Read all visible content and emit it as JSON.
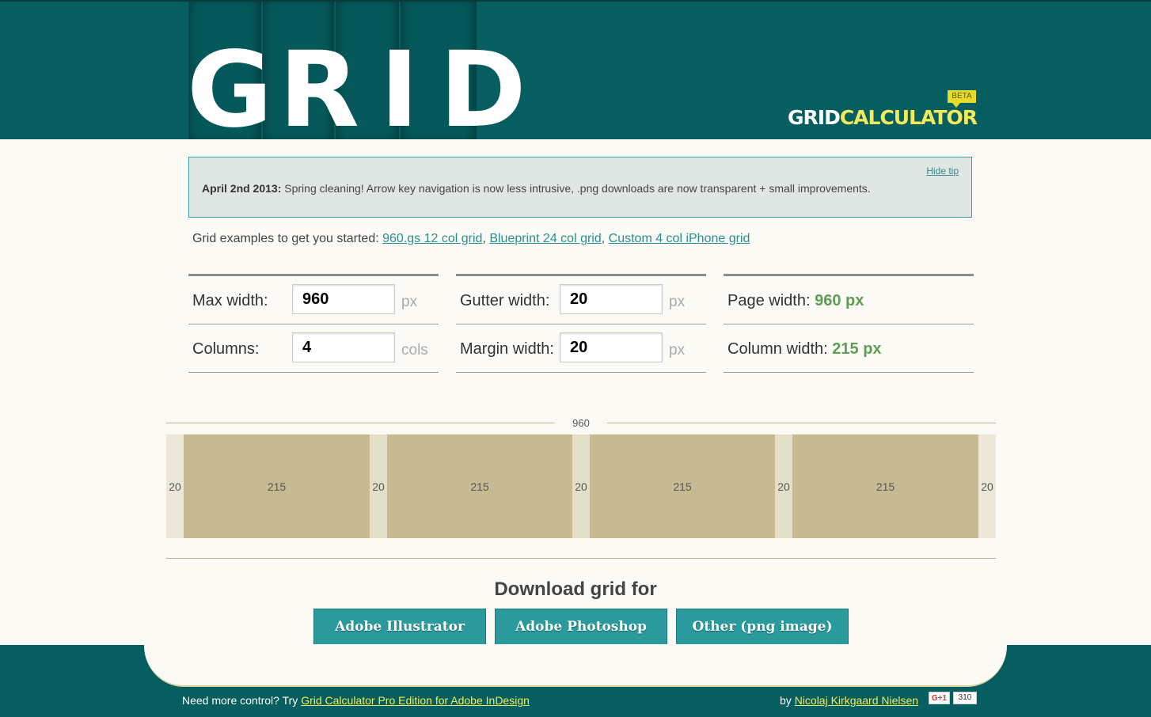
{
  "header": {
    "logo_letters": [
      "G",
      "R",
      "I",
      "D"
    ],
    "brand_grid": "GRID",
    "brand_calculator": "CALCULATOR",
    "beta": "BETA"
  },
  "tip": {
    "date": "April 2nd 2013:",
    "text": "Spring cleaning! Arrow key navigation is now less intrusive, .png downloads are now transparent + small improvements.",
    "hide_label": "Hide tip"
  },
  "examples": {
    "intro": "Grid examples to get you started:",
    "links": [
      "960.gs 12 col grid",
      "Blueprint 24 col grid",
      "Custom 4 col iPhone grid"
    ]
  },
  "form": {
    "max_width": {
      "label": "Max width:",
      "value": "960",
      "unit": "px"
    },
    "columns": {
      "label": "Columns:",
      "value": "4",
      "unit": "cols"
    },
    "gutter_width": {
      "label": "Gutter width:",
      "value": "20",
      "unit": "px"
    },
    "margin_width": {
      "label": "Margin width:",
      "value": "20",
      "unit": "px"
    },
    "page_width": {
      "label": "Page width:",
      "value": "960 px"
    },
    "column_width": {
      "label": "Column width:",
      "value": "215 px"
    }
  },
  "grid_preview": {
    "total_label": "960",
    "margin": "20",
    "gutter": "20",
    "column": "215",
    "column_count": 4
  },
  "download": {
    "title": "Download grid for",
    "buttons": [
      "Adobe Illustrator",
      "Adobe Photoshop",
      "Other (png image)"
    ]
  },
  "footer": {
    "left_text": "Need more control? Try",
    "left_link": "Grid Calculator Pro Edition for Adobe InDesign",
    "right_text": "by",
    "right_link": "Nicolaj Kirkgaard Nielsen",
    "gplus": "G+1",
    "gplus_count": "310"
  },
  "colors": {
    "header_teal": "#075e60",
    "accent_yellow": "#f2ea5a",
    "result_green": "#5f9d55",
    "button_teal": "#2a9a9c",
    "column_tan": "#c5ba92"
  }
}
